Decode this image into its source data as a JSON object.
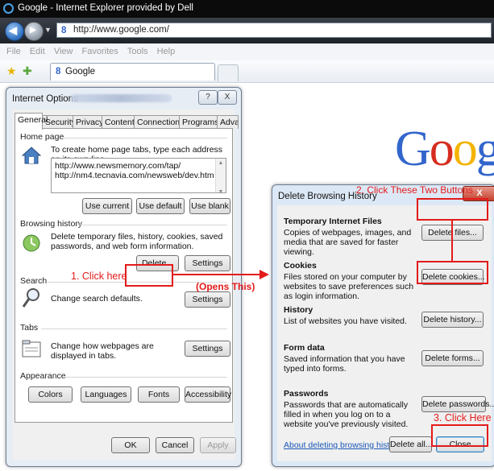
{
  "window": {
    "title": "Google - Internet Explorer provided by Dell"
  },
  "address": {
    "url": "http://www.google.com/"
  },
  "menu": [
    "File",
    "Edit",
    "View",
    "Favorites",
    "Tools",
    "Help"
  ],
  "favorites_bar": {
    "tab_title": "Google"
  },
  "page": {
    "logo_text": "Goog"
  },
  "internet_options": {
    "title": "Internet Options",
    "help": "?",
    "close": "X",
    "tabs": [
      "General",
      "Security",
      "Privacy",
      "Content",
      "Connections",
      "Programs",
      "Advanced"
    ],
    "home_page": {
      "label": "Home page",
      "description": "To create home page tabs, type each address on its own line.",
      "urls": [
        "http://www.newsmemory.com/tap/",
        "http://nm4.tecnavia.com/newsweb/dev.htm"
      ],
      "buttons": [
        "Use current",
        "Use default",
        "Use blank"
      ]
    },
    "browsing_history": {
      "label": "Browsing history",
      "description": "Delete temporary files, history, cookies, saved passwords, and web form information.",
      "delete": "Delete...",
      "settings": "Settings"
    },
    "search": {
      "label": "Search",
      "description": "Change search defaults.",
      "settings": "Settings"
    },
    "tabs_group": {
      "label": "Tabs",
      "description": "Change how webpages are displayed in tabs.",
      "settings": "Settings"
    },
    "appearance": {
      "label": "Appearance",
      "buttons": [
        "Colors",
        "Languages",
        "Fonts",
        "Accessibility"
      ]
    },
    "footer": {
      "ok": "OK",
      "cancel": "Cancel",
      "apply": "Apply"
    }
  },
  "delete_history": {
    "title": "Delete Browsing History",
    "close": "X",
    "sections": [
      {
        "heading": "Temporary Internet Files",
        "desc": "Copies of webpages, images, and media that are saved for faster viewing.",
        "button": "Delete files..."
      },
      {
        "heading": "Cookies",
        "desc": "Files stored on your computer by websites to save preferences such as login information.",
        "button": "Delete cookies..."
      },
      {
        "heading": "History",
        "desc": "List of websites you have visited.",
        "button": "Delete history..."
      },
      {
        "heading": "Form data",
        "desc": "Saved information that you have typed into forms.",
        "button": "Delete forms..."
      },
      {
        "heading": "Passwords",
        "desc": "Passwords that are automatically filled in when you log on to a website you've previously visited.",
        "button": "Delete passwords..."
      }
    ],
    "link": "About deleting browsing history",
    "delete_all": "Delete all...",
    "close_button": "Close"
  },
  "annotations": {
    "step1": "1. Click here",
    "step2": "2. Click These Two Buttons",
    "step3": "3. Click Here",
    "opens": "(Opens This)",
    "color": "#e31b1b"
  }
}
